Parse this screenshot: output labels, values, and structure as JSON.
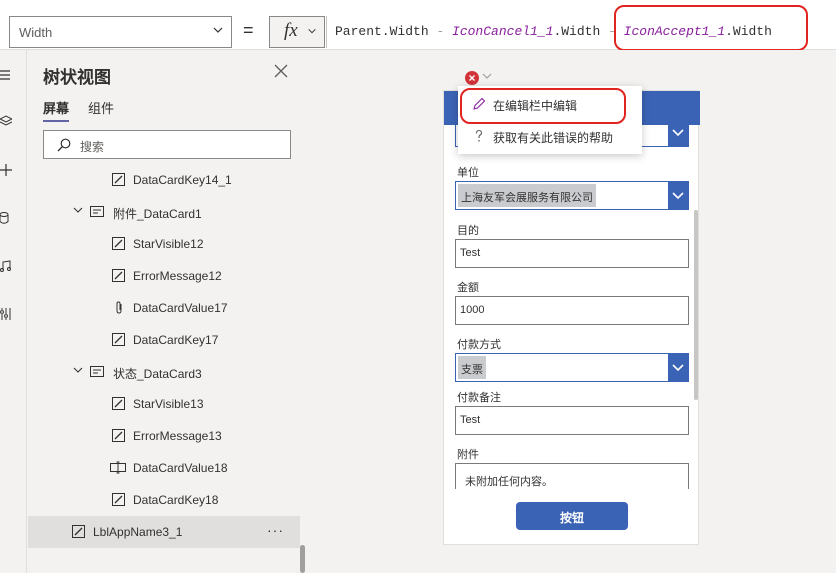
{
  "formula_bar": {
    "property": "Width",
    "equals": "=",
    "fx_label": "fx",
    "tokens": [
      {
        "text": "Parent.Width",
        "kind": "plain"
      },
      {
        "text": " - ",
        "kind": "op"
      },
      {
        "text": "IconCancel1_1",
        "kind": "ctrl"
      },
      {
        "text": ".Width ",
        "kind": "plain"
      },
      {
        "text": "- ",
        "kind": "op"
      },
      {
        "text": "IconAccept1_1",
        "kind": "ctrl"
      },
      {
        "text": ".Width",
        "kind": "plain"
      }
    ]
  },
  "tree": {
    "title": "树状视图",
    "tabs": {
      "screens": "屏幕",
      "components": "组件"
    },
    "search_placeholder": "搜索",
    "nodes": [
      {
        "label": "DataCardKey14_1",
        "icon": "edit-label-icon",
        "indent": 2
      },
      {
        "label": "附件_DataCard1",
        "icon": "card-icon",
        "indent": 1,
        "expanded": true
      },
      {
        "label": "StarVisible12",
        "icon": "edit-label-icon",
        "indent": 2
      },
      {
        "label": "ErrorMessage12",
        "icon": "edit-label-icon",
        "indent": 2
      },
      {
        "label": "DataCardValue17",
        "icon": "attachment-icon",
        "indent": 2
      },
      {
        "label": "DataCardKey17",
        "icon": "edit-label-icon",
        "indent": 2
      },
      {
        "label": "状态_DataCard3",
        "icon": "card-icon",
        "indent": 1,
        "expanded": true
      },
      {
        "label": "StarVisible13",
        "icon": "edit-label-icon",
        "indent": 2
      },
      {
        "label": "ErrorMessage13",
        "icon": "edit-label-icon",
        "indent": 2
      },
      {
        "label": "DataCardValue18",
        "icon": "text-input-icon",
        "indent": 2
      },
      {
        "label": "DataCardKey18",
        "icon": "edit-label-icon",
        "indent": 2
      },
      {
        "label": "LblAppName3_1",
        "icon": "edit-label-icon",
        "indent": 0,
        "selected": true
      }
    ],
    "more_label": "···"
  },
  "context_menu": {
    "edit_in_formula_bar": "在编辑栏中编辑",
    "get_help": "获取有关此错误的帮助"
  },
  "form": {
    "unit_label": "单位",
    "unit_value": "上海友军会展服务有限公司",
    "purpose_label": "目的",
    "purpose_value": "Test",
    "amount_label": "金额",
    "amount_value": "1000",
    "payment_method_label": "付款方式",
    "payment_method_value": "支票",
    "payment_note_label": "付款备注",
    "payment_note_value": "Test",
    "attachment_label": "附件",
    "attachment_value": "未附加任何内容。",
    "submit_label": "按钮"
  },
  "colors": {
    "header_blue": "#3b63b5",
    "error_red": "#d13438",
    "annotation_red": "#e0241f",
    "control_name_purple": "#8a1f9e"
  }
}
